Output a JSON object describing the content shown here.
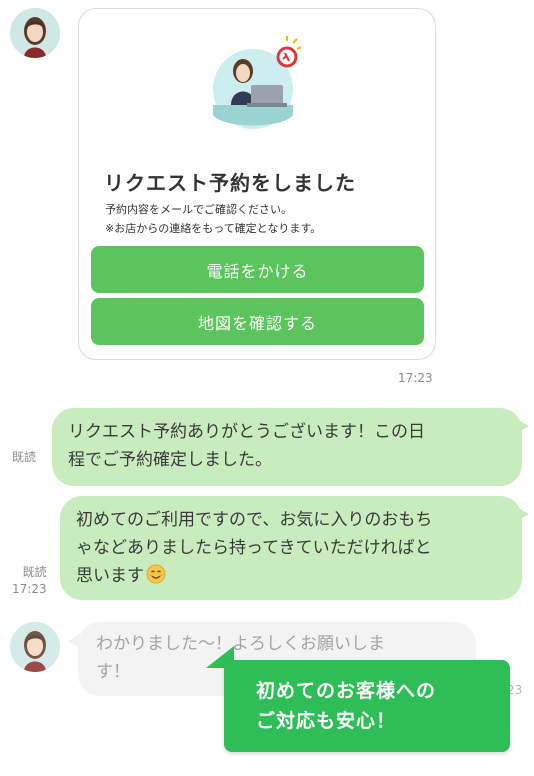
{
  "colors": {
    "accent_button": "#5cc45c",
    "outgoing_bubble": "#c8ecbd",
    "incoming_bubble": "#f2f2f2",
    "callout": "#2ebd57"
  },
  "card": {
    "title": "リクエスト予約をしました",
    "desc_line1": "予約内容をメールでご確認ください。",
    "desc_line2": "※お店からの連絡をもって確定となります。",
    "button_call": "電話をかける",
    "button_map": "地図を確認する",
    "time": "17:23"
  },
  "messages": [
    {
      "read": "既読",
      "line1": "リクエスト予約ありがとうございます！この日",
      "line2": "程でご予約確定しました。"
    },
    {
      "read": "既読",
      "time": "17:23",
      "line1": "初めてのご利用ですので、お気に入りのおもち",
      "line2": "ゃなどありましたら持ってきていただければと",
      "line3": "思います",
      "emoji": "smiling-face"
    }
  ],
  "reply": {
    "line1": "わかりました〜！よろしくお願いしま",
    "line2": "す！",
    "time_partial": "23"
  },
  "callout": {
    "line1": "初めてのお客様への",
    "line2": "ご対応も安心！"
  }
}
